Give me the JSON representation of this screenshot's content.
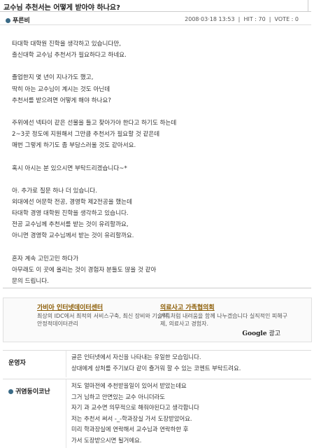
{
  "post": {
    "title": "교수님 추천서는 어떻게 받아야 하나요?",
    "author": "푸른비",
    "date": "2008·03·18 13:53",
    "hit": "HIT : 70",
    "vote": "VOTE : 0",
    "paragraphs": [
      [
        "타대학 대학원 진학을 생각하고 있습니다만,",
        "출신대학 교수님 추천서가 필요하다고 하네요."
      ],
      [
        "졸업한지 몇 년이 지나가도 했고,",
        "딱히 아는 교수님이 계시는 것도 아닌데",
        "추천서를 받으려면 어떻게 해야 하나요?"
      ],
      [
        "주위에선 넥타이 같은 선물을 들고 찾아가야 한다고 하기도 하는데",
        "2~3곳 정도에 지원해서 그만큼 추천서가 필요할 것 같은데",
        "매번 그렇게 하기도 좀 부담스러울 것도 같아서요."
      ],
      [
        "혹시 아시는 분 있으시면 부탁드리겠습니다~*"
      ],
      [
        "아. 추가로 질문 하나 더 있습니다.",
        "외대에선 어문학 전공, 경영학 제2전공을 했는데",
        "타대학 경영 대학원 진학을 생각하고 있습니다.",
        "전공 교수님께 추천서를 받는 것이 유리할까요,",
        "아니면 경영학 교수님께서 받는 것이 유리할까요."
      ],
      [
        "혼자 계속 고민고민 하다가",
        "아무래도 이 곳에 올리는 것이 경험자 분들도 많을 것 같아",
        "문의 드립니다."
      ]
    ]
  },
  "ads": [
    {
      "title": "가비아 인터넷데이터센터",
      "desc": "최상의 IDC에서 최적의 서비스구축, 최신 장비와 기술력, 안정적데이터관리"
    },
    {
      "title": "의료사고 가족협의회",
      "desc": "가족처럼 내려움을 함께 나누겠습니다 실직적인 피해구제, 의료사고 경험자."
    }
  ],
  "google_ad": {
    "brand": "Google",
    "suffix": "광고"
  },
  "comments": [
    {
      "author": "운영자",
      "lines": [
        "글은 인터넷에서 자신을 나타내는 유일한 모습입니다.",
        "상대에게 상처를 주기보다 같이 즐거워 할 수 있는 코멘트 부탁드려요."
      ]
    },
    {
      "author": "귀염둥이코난",
      "lines": [
        "저도 얼마전에 추천받을일이 있어서 받았는데요",
        "그거 님하고 안면있는 교수 아니더라도",
        "자기 과 교수면 의무적으로 해줘야된다고 생각합니다",
        "저는 추천서 써서 -_-학과장실 가서 도장받았어요.",
        "미리 학과장실에 연락해서 교수님과 연락하한 후",
        "가서 도장받으시면 될거에요."
      ]
    }
  ],
  "colors": {
    "bullet": "#3a6a86",
    "ad_title": "#8a5a00"
  }
}
